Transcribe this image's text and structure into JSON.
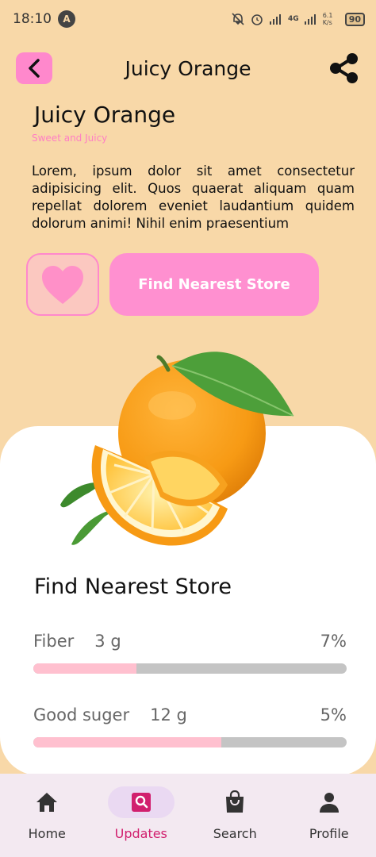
{
  "status_bar": {
    "time": "18:10",
    "network": "4G",
    "speed": "6.1 K/s",
    "battery": "90",
    "icons": [
      "a-app-icon",
      "mute-icon",
      "alarm-icon",
      "signal-icon",
      "wifi-icon",
      "battery-icon"
    ]
  },
  "app_bar": {
    "title": "Juicy Orange",
    "back_icon": "chevron-left-icon",
    "share_icon": "share-icon"
  },
  "product": {
    "title": "Juicy Orange",
    "subtitle": "Sweet and Juicy",
    "description": "Lorem, ipsum dolor sit amet consectetur adipisicing elit. Quos quaerat aliquam quam repellat dolorem eveniet laudantium quidem dolorum animi! Nihil enim praesentium"
  },
  "actions": {
    "favorite_icon": "heart-icon",
    "find_store_label": "Find Nearest Store"
  },
  "details": {
    "section_title": "Find Nearest Store",
    "nutrients": [
      {
        "name": "Fiber",
        "amount": "3 g",
        "percent": "7%",
        "fill": 0.33
      },
      {
        "name": "Good suger",
        "amount": "12 g",
        "percent": "5%",
        "fill": 0.6
      }
    ]
  },
  "colors": {
    "background": "#f8d8a8",
    "accent_pink": "#ff88cc",
    "active_nav": "#d11f6e"
  },
  "bottom_nav": {
    "items": [
      {
        "label": "Home",
        "icon": "home-icon"
      },
      {
        "label": "Updates",
        "icon": "search-box-icon"
      },
      {
        "label": "Search",
        "icon": "shopping-bag-icon"
      },
      {
        "label": "Profile",
        "icon": "person-icon"
      }
    ]
  }
}
